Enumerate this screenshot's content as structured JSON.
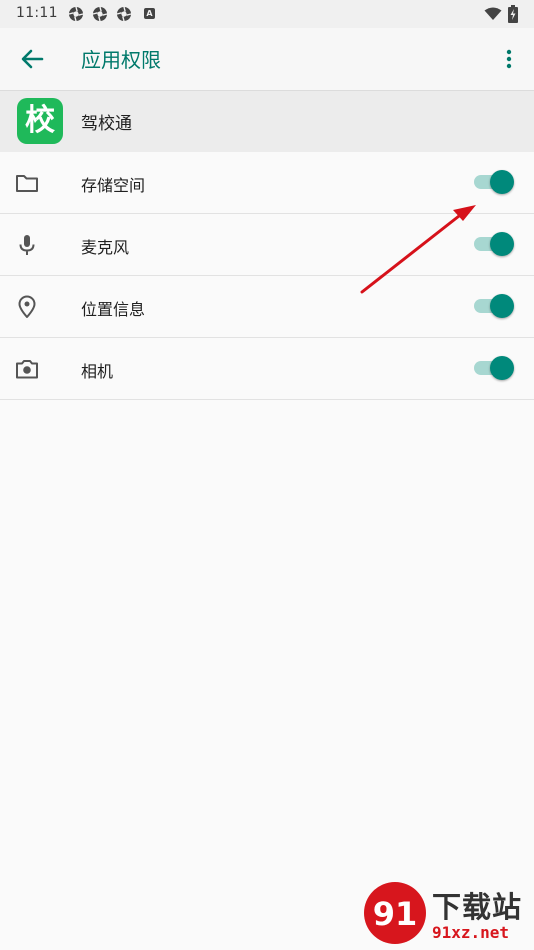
{
  "status_bar": {
    "time": "11:11",
    "icons": [
      "aperture-icon",
      "aperture-icon",
      "aperture-icon",
      "a-badge-icon"
    ],
    "right_icons": [
      "wifi-icon",
      "battery-charging-icon"
    ]
  },
  "app_bar": {
    "title": "应用权限",
    "back_icon": "arrow-left-icon",
    "menu_icon": "more-vert-icon"
  },
  "app": {
    "icon_glyph": "校",
    "name": "驾校通",
    "icon_color": "#1fb95a"
  },
  "permissions": [
    {
      "label": "存储空间",
      "icon": "folder-icon",
      "enabled": true
    },
    {
      "label": "麦克风",
      "icon": "mic-icon",
      "enabled": true
    },
    {
      "label": "位置信息",
      "icon": "location-pin-icon",
      "enabled": true
    },
    {
      "label": "相机",
      "icon": "camera-icon",
      "enabled": true
    }
  ],
  "colors": {
    "accent": "#00796b",
    "toggle_thumb_on": "#00897b",
    "toggle_track_on": "#a7d7d1",
    "annotation_arrow": "#d6111a"
  },
  "watermark": {
    "title": "下载站",
    "url": "91xz.net",
    "logo_text": "91"
  }
}
